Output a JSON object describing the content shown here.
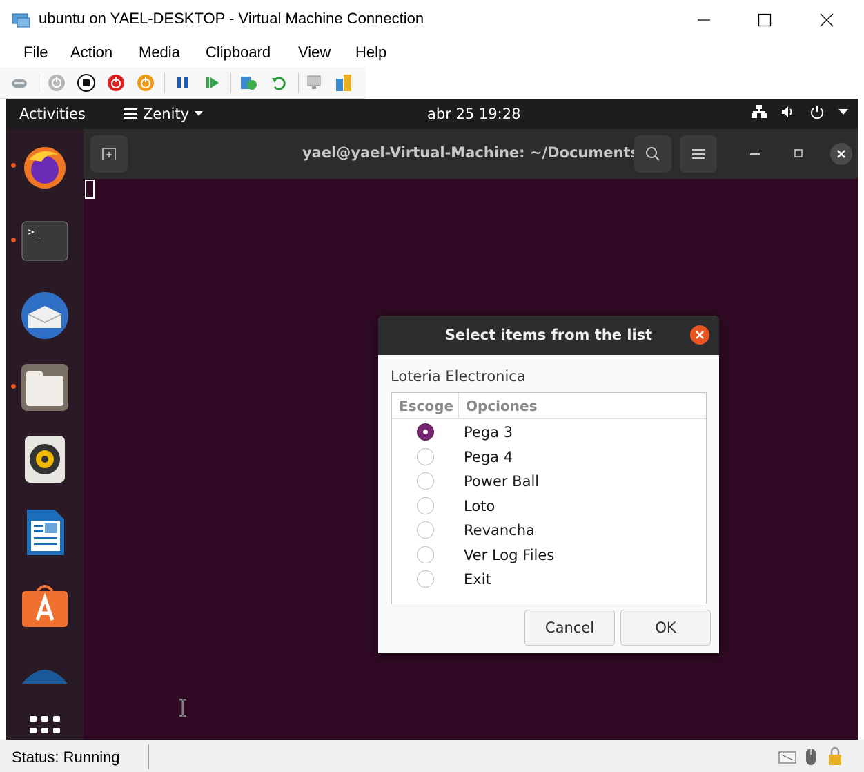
{
  "window": {
    "title": "ubuntu on YAEL-DESKTOP - Virtual Machine Connection",
    "controls": {
      "minimize": "—",
      "maximize": "☐",
      "close": "✕"
    }
  },
  "menubar": {
    "items": [
      "File",
      "Action",
      "Media",
      "Clipboard",
      "View",
      "Help"
    ]
  },
  "toolbar": {
    "buttons": [
      "ctrl-alt-del-icon",
      "start-icon",
      "turn-off-icon",
      "shut-down-icon",
      "save-icon",
      "pause-icon",
      "resume-icon",
      "checkpoint-icon",
      "revert-icon",
      "enhanced-session-icon",
      "share-icon"
    ]
  },
  "ubuntu": {
    "topbar": {
      "activities": "Activities",
      "app_name": "Zenity",
      "clock": "abr 25  19:28"
    },
    "dock": [
      "firefox-icon",
      "terminal-icon",
      "thunderbird-icon",
      "files-icon",
      "rhythmbox-icon",
      "writer-icon",
      "software-icon",
      "help-icon",
      "show-apps-icon"
    ]
  },
  "terminal": {
    "title": "yael@yael-Virtual-Machine: ~/Documents"
  },
  "dialog": {
    "title": "Select items from the list",
    "text": "Loteria Electronica",
    "columns": [
      "Escoge",
      "Opciones"
    ],
    "options": [
      {
        "label": "Pega 3",
        "selected": true
      },
      {
        "label": "Pega 4",
        "selected": false
      },
      {
        "label": "Power Ball",
        "selected": false
      },
      {
        "label": "Loto",
        "selected": false
      },
      {
        "label": "Revancha",
        "selected": false
      },
      {
        "label": "Ver Log Files",
        "selected": false
      },
      {
        "label": "Exit",
        "selected": false
      }
    ],
    "cancel": "Cancel",
    "ok": "OK"
  },
  "statusbar": {
    "status": "Status: Running"
  },
  "colors": {
    "accent": "#e95420",
    "radio_selected": "#762572",
    "terminal_bg": "#300a24"
  }
}
